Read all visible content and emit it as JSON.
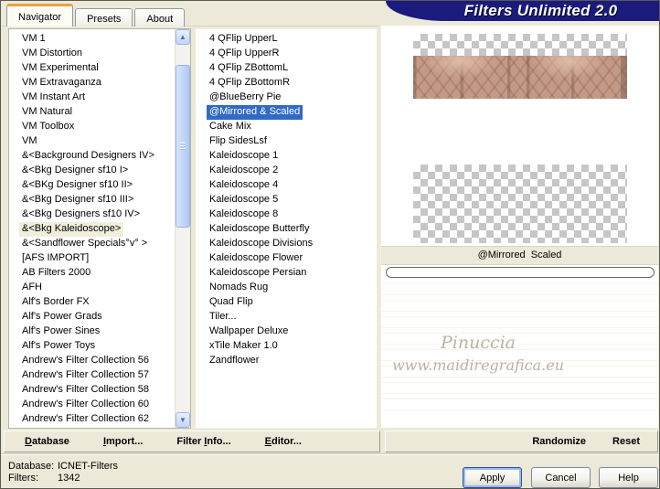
{
  "window": {
    "title": "Filters Unlimited 2.0"
  },
  "colors": {
    "beige": "#ECE9D8",
    "navy": "#1B1B7E",
    "tab-orange": "#E8A33D",
    "selection-blue": "#316AC5",
    "inactive-sel": "#F1EEDB"
  },
  "tabs": [
    {
      "label": "Navigator",
      "active": true
    },
    {
      "label": "Presets",
      "active": false
    },
    {
      "label": "About",
      "active": false
    }
  ],
  "category_list": {
    "items": [
      {
        "label": "VM 1"
      },
      {
        "label": "VM Distortion"
      },
      {
        "label": "VM Experimental"
      },
      {
        "label": "VM Extravaganza"
      },
      {
        "label": "VM Instant Art"
      },
      {
        "label": "VM Natural"
      },
      {
        "label": "VM Toolbox"
      },
      {
        "label": "VM"
      },
      {
        "label": "&<Background Designers IV>"
      },
      {
        "label": "&<Bkg Designer sf10 I>"
      },
      {
        "label": "&<BKg Designer sf10 II>"
      },
      {
        "label": "&<Bkg Designer sf10 III>"
      },
      {
        "label": "&<Bkg Designers sf10 IV>"
      },
      {
        "label": "&<Bkg Kaleidoscope>",
        "selected": true
      },
      {
        "label": "&<Sandflower Specials°v° >"
      },
      {
        "label": "[AFS IMPORT]"
      },
      {
        "label": "AB Filters 2000"
      },
      {
        "label": "AFH"
      },
      {
        "label": "Alf's Border FX"
      },
      {
        "label": "Alf's Power Grads"
      },
      {
        "label": "Alf's Power Sines"
      },
      {
        "label": "Alf's Power Toys"
      },
      {
        "label": "Andrew's Filter Collection 56"
      },
      {
        "label": "Andrew's Filter Collection 57"
      },
      {
        "label": "Andrew's Filter Collection 58"
      },
      {
        "label": "Andrew's Filter Collection 60"
      },
      {
        "label": "Andrew's Filter Collection 62"
      }
    ]
  },
  "filter_list": {
    "items": [
      {
        "label": "4 QFlip UpperL"
      },
      {
        "label": "4 QFlip UpperR"
      },
      {
        "label": "4 QFlip ZBottomL"
      },
      {
        "label": "4 QFlip ZBottomR"
      },
      {
        "label": "@BlueBerry Pie"
      },
      {
        "label": "@Mirrored & Scaled",
        "selected": true
      },
      {
        "label": "Cake Mix"
      },
      {
        "label": "Flip SidesLsf"
      },
      {
        "label": "Kaleidoscope 1"
      },
      {
        "label": "Kaleidoscope 2"
      },
      {
        "label": "Kaleidoscope 4"
      },
      {
        "label": "Kaleidoscope 5"
      },
      {
        "label": "Kaleidoscope 8"
      },
      {
        "label": "Kaleidoscope Butterfly"
      },
      {
        "label": "Kaleidoscope Divisions"
      },
      {
        "label": "Kaleidoscope Flower"
      },
      {
        "label": "Kaleidoscope Persian"
      },
      {
        "label": "Nomads Rug"
      },
      {
        "label": "Quad Flip"
      },
      {
        "label": "Tiler..."
      },
      {
        "label": "Wallpaper Deluxe"
      },
      {
        "label": "xTile Maker 1.0"
      },
      {
        "label": "Zandflower"
      }
    ]
  },
  "preview": {
    "filter_label": "@Mirrored  Scaled",
    "watermark_line1": "Pinuccia",
    "watermark_line2": "www.maidiregrafica.eu"
  },
  "toolbar": {
    "items": [
      {
        "pre": "",
        "key": "D",
        "post": "atabase"
      },
      {
        "pre": "",
        "key": "I",
        "post": "mport..."
      },
      {
        "pre": "Filter ",
        "key": "I",
        "post": "nfo..."
      },
      {
        "pre": "",
        "key": "E",
        "post": "ditor..."
      }
    ],
    "randomize": "Randomize",
    "reset": "Reset"
  },
  "status": {
    "database_label": "Database:",
    "database_value": "ICNET-Filters",
    "filters_label": "Filters:",
    "filters_value": "1342"
  },
  "actions": {
    "apply": "Apply",
    "cancel": "Cancel",
    "help": "Help"
  }
}
